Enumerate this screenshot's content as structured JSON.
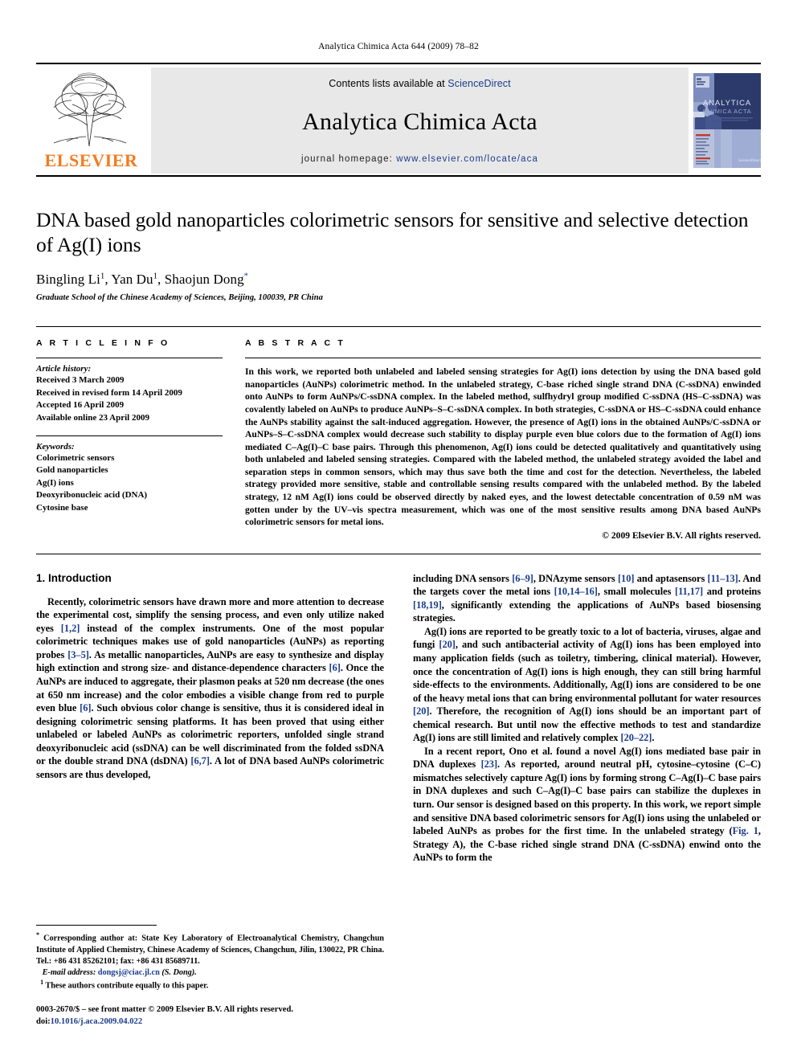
{
  "running_head": "Analytica Chimica Acta 644 (2009) 78–82",
  "masthead": {
    "publisher": "ELSEVIER",
    "contents_prefix": "Contents lists available at ",
    "contents_link": "ScienceDirect",
    "journal_name": "Analytica Chimica Acta",
    "homepage_label": "journal homepage:",
    "homepage_url": "www.elsevier.com/locate/aca",
    "cover_title_line1": "ANALYTICA",
    "cover_title_line2": "CHIMICA ACTA",
    "link_color": "#1a3c8c",
    "elsevier_orange": "#F47B20",
    "band_gray": "#e8e8e8"
  },
  "title": "DNA based gold nanoparticles colorimetric sensors for sensitive and selective detection of Ag(I) ions",
  "authors": {
    "a1_name": "Bingling Li",
    "a1_mark": "1",
    "a2_name": "Yan Du",
    "a2_mark": "1",
    "a3_name": "Shaojun Dong",
    "a3_mark": "*"
  },
  "affiliation": "Graduate School of the Chinese Academy of Sciences, Beijing, 100039, PR China",
  "article_info": {
    "heading": "A R T I C L E    I N F O",
    "history_label": "Article history:",
    "history": [
      "Received 3 March 2009",
      "Received in revised form 14 April 2009",
      "Accepted 16 April 2009",
      "Available online 23 April 2009"
    ],
    "keywords_label": "Keywords:",
    "keywords": [
      "Colorimetric sensors",
      "Gold nanoparticles",
      "Ag(I) ions",
      "Deoxyribonucleic acid (DNA)",
      "Cytosine base"
    ]
  },
  "abstract": {
    "heading": "A B S T R A C T",
    "text": "In this work, we reported both unlabeled and labeled sensing strategies for Ag(I) ions detection by using the DNA based gold nanoparticles (AuNPs) colorimetric method. In the unlabeled strategy, C-base riched single strand DNA (C-ssDNA) enwinded onto AuNPs to form AuNPs/C-ssDNA complex. In the labeled method, sulfhydryl group modified C-ssDNA (HS–C-ssDNA) was covalently labeled on AuNPs to produce AuNPs–S–C-ssDNA complex. In both strategies, C-ssDNA or HS–C-ssDNA could enhance the AuNPs stability against the salt-induced aggregation. However, the presence of Ag(I) ions in the obtained AuNPs/C-ssDNA or AuNPs–S–C-ssDNA complex would decrease such stability to display purple even blue colors due to the formation of Ag(I) ions mediated C–Ag(I)–C base pairs. Through this phenomenon, Ag(I) ions could be detected qualitatively and quantitatively using both unlabeled and labeled sensing strategies. Compared with the labeled method, the unlabeled strategy avoided the label and separation steps in common sensors, which may thus save both the time and cost for the detection. Nevertheless, the labeled strategy provided more sensitive, stable and controllable sensing results compared with the unlabeled method. By the labeled strategy, 12 nM Ag(I) ions could be observed directly by naked eyes, and the lowest detectable concentration of 0.59 nM was gotten under by the UV–vis spectra measurement, which was one of the most sensitive results among DNA based AuNPs colorimetric sensors for metal ions.",
    "copyright": "© 2009 Elsevier B.V. All rights reserved."
  },
  "body": {
    "section_number": "1.",
    "section_title": "Introduction",
    "left_paragraph_1_a": "Recently, colorimetric sensors have drawn more and more attention to decrease the experimental cost, simplify the sensing process, and even only utilize naked eyes ",
    "left_ref_1": "[1,2]",
    "left_paragraph_1_b": " instead of the complex instruments. One of the most popular colorimetric techniques makes use of gold nanoparticles (AuNPs) as reporting probes ",
    "left_ref_2": "[3–5]",
    "left_paragraph_1_c": ". As metallic nanoparticles, AuNPs are easy to synthesize and display high extinction and strong size- and distance-dependence characters ",
    "left_ref_3": "[6]",
    "left_paragraph_1_d": ". Once the AuNPs are induced to aggregate, their plasmon peaks at 520 nm decrease (the ones at 650 nm increase) and the color embodies a visible change from red to purple even blue ",
    "left_ref_4": "[6]",
    "left_paragraph_1_e": ". Such obvious color change is sensitive, thus it is considered ideal in designing colorimetric sensing platforms. It has been proved that using either unlabeled or labeled AuNPs as colorimetric reporters, unfolded single strand deoxyribonucleic acid (ssDNA) can be well discriminated from the folded ssDNA or the double strand DNA (dsDNA) ",
    "left_ref_5": "[6,7]",
    "left_paragraph_1_f": ". A lot of DNA based AuNPs colorimetric sensors are thus developed,",
    "right_paragraph_1_a": "including DNA sensors ",
    "right_ref_1": "[6–9]",
    "right_paragraph_1_b": ", DNAzyme sensors ",
    "right_ref_2": "[10]",
    "right_paragraph_1_c": " and aptasensors ",
    "right_ref_3": "[11–13]",
    "right_paragraph_1_d": ". And the targets cover the metal ions ",
    "right_ref_4": "[10,14–16]",
    "right_paragraph_1_e": ", small molecules ",
    "right_ref_5": "[11,17]",
    "right_paragraph_1_f": " and proteins ",
    "right_ref_6": "[18,19]",
    "right_paragraph_1_g": ", significantly extending the applications of AuNPs based biosensing strategies.",
    "right_paragraph_2_a": "Ag(I) ions are reported to be greatly toxic to a lot of bacteria, viruses, algae and fungi ",
    "right_ref_7": "[20]",
    "right_paragraph_2_b": ", and such antibacterial activity of Ag(I) ions has been employed into many application fields (such as toiletry, timbering, clinical material). However, once the concentration of Ag(I) ions is high enough, they can still bring harmful side-effects to the environments. Additionally, Ag(I) ions are considered to be one of the heavy metal ions that can bring environmental pollutant for water resources ",
    "right_ref_8": "[20]",
    "right_paragraph_2_c": ". Therefore, the recognition of Ag(I) ions should be an important part of chemical research. But until now the effective methods to test and standardize Ag(I) ions are still limited and relatively complex ",
    "right_ref_9": "[20–22]",
    "right_paragraph_2_d": ".",
    "right_paragraph_3_a": "In a recent report, Ono et al. found a novel Ag(I) ions mediated base pair in DNA duplexes ",
    "right_ref_10": "[23]",
    "right_paragraph_3_b": ". As reported, around neutral pH, cytosine–cytosine (C–C) mismatches selectively capture Ag(I) ions by forming strong C–Ag(I)–C base pairs in DNA duplexes and such C–Ag(I)–C base pairs can stabilize the duplexes in turn. Our sensor is designed based on this property. In this work, we report simple and sensitive DNA based colorimetric sensors for Ag(I) ions using the unlabeled or labeled AuNPs as probes for the first time. In the unlabeled strategy (",
    "right_ref_11": "Fig. 1",
    "right_paragraph_3_c": ", Strategy A), the C-base riched single strand DNA (C-ssDNA) enwind onto the AuNPs to form the"
  },
  "footnotes": {
    "corresponding_mark": "*",
    "corresponding_text": "Corresponding author at: State Key Laboratory of Electroanalytical Chemistry, Changchun Institute of Applied Chemistry, Chinese Academy of Sciences, Changchun, Jilin, 130022, PR China. Tel.: +86 431 85262101; fax: +86 431 85689711.",
    "email_label": "E-mail address:",
    "email": "dongsj@ciac.jl.cn",
    "email_suffix": "(S. Dong).",
    "equal_mark": "1",
    "equal_text": "These authors contribute equally to this paper."
  },
  "imprint": {
    "issn_line": "0003-2670/$ – see front matter © 2009 Elsevier B.V. All rights reserved.",
    "doi_label": "doi:",
    "doi": "10.1016/j.aca.2009.04.022"
  }
}
